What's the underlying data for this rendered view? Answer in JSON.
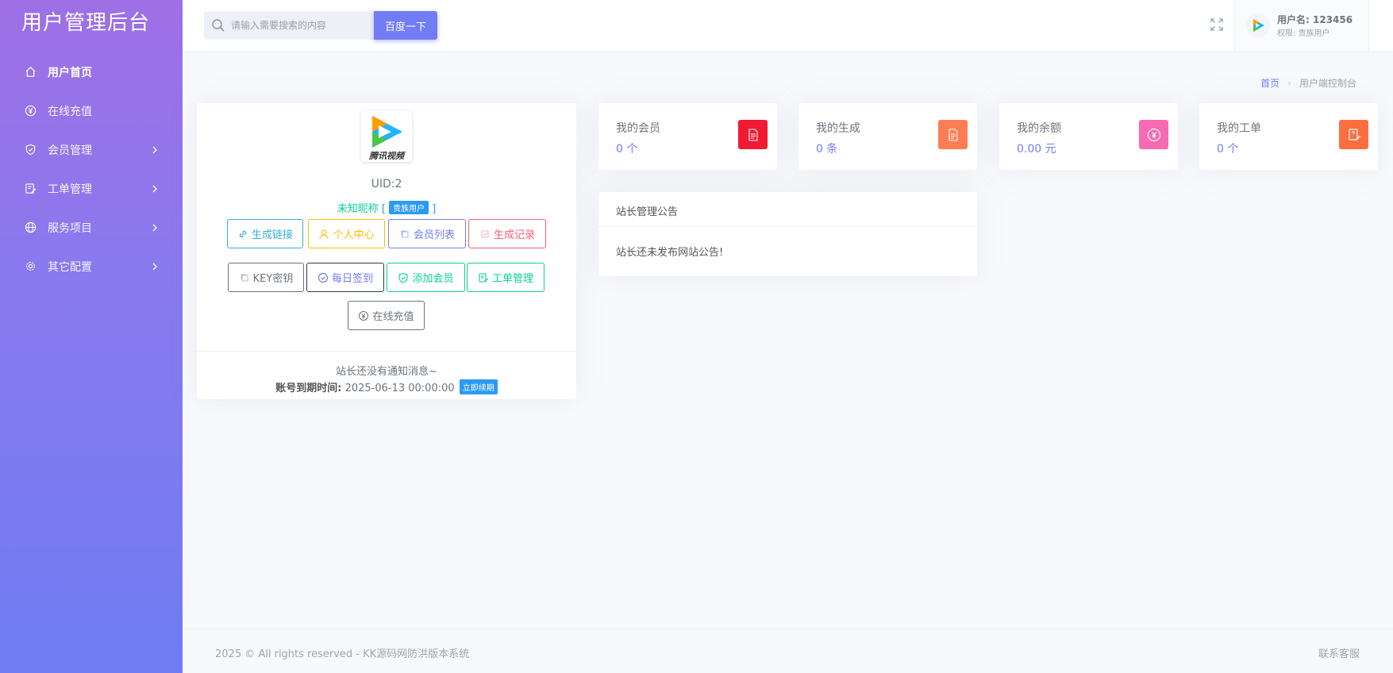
{
  "app": {
    "title": "用户管理后台"
  },
  "sidebar": {
    "items": [
      {
        "label": "用户首页",
        "icon": "home-icon",
        "active": true,
        "has_arrow": false
      },
      {
        "label": "在线充值",
        "icon": "yen-circle-icon",
        "active": false,
        "has_arrow": false
      },
      {
        "label": "会员管理",
        "icon": "shield-check-icon",
        "active": false,
        "has_arrow": true
      },
      {
        "label": "工单管理",
        "icon": "ticket-edit-icon",
        "active": false,
        "has_arrow": true
      },
      {
        "label": "服务项目",
        "icon": "globe-icon",
        "active": false,
        "has_arrow": true
      },
      {
        "label": "其它配置",
        "icon": "settings-gear-icon",
        "active": false,
        "has_arrow": true
      }
    ]
  },
  "search": {
    "placeholder": "请输入需要搜索的内容",
    "value": "",
    "button_label": "百度一下"
  },
  "user": {
    "name_label": "用户名: 123456",
    "role_label": "权限: 贵族用户"
  },
  "breadcrumb": {
    "home": "首页",
    "current": "用户端控制台"
  },
  "profile": {
    "logo_text": "腾讯视频",
    "uid": "UID:2",
    "nickname": "未知昵称",
    "bracket_open": "[",
    "bracket_close": "]",
    "role_badge": "贵族用户",
    "buttons": [
      {
        "label": "生成链接",
        "icon": "link-icon",
        "color": "#39afd1"
      },
      {
        "label": "个人中心",
        "icon": "user-icon",
        "color": "#ffbc00"
      },
      {
        "label": "会员列表",
        "icon": "copy-icon",
        "color": "#727cf5"
      },
      {
        "label": "生成记录",
        "icon": "chart-icon",
        "color": "#fa5c7c"
      },
      {
        "label": "KEY密钥",
        "icon": "copy-icon",
        "color": "#6c757d"
      },
      {
        "label": "每日签到",
        "icon": "check-circle-icon",
        "color": "#313a46"
      },
      {
        "label": "添加会员",
        "icon": "shield-check-icon",
        "color": "#0acf97"
      },
      {
        "label": "工单管理",
        "icon": "ticket-edit-icon",
        "color": "#0acf97"
      },
      {
        "label": "在线充值",
        "icon": "yen-circle-icon",
        "color": "#6c757d"
      }
    ],
    "notice": "站长还没有通知消息~",
    "expire_label": "账号到期时间:",
    "expire_value": "2025-06-13 00:00:00",
    "renew_label": "立即续期"
  },
  "stats": [
    {
      "title": "我的会员",
      "value": "0 个",
      "icon": "document-icon",
      "color": "#f01a33"
    },
    {
      "title": "我的生成",
      "value": "0 条",
      "icon": "document-icon",
      "color": "#fd7e54"
    },
    {
      "title": "我的余额",
      "value": "0.00 元",
      "icon": "yen-circle-icon",
      "color": "#f86ab1"
    },
    {
      "title": "我的工单",
      "value": "0 个",
      "icon": "ticket-edit-icon",
      "color": "#fd6e3e"
    }
  ],
  "announcement": {
    "title": "站长管理公告",
    "body": "站长还未发布网站公告!"
  },
  "footer": {
    "copyright": "2025 © All rights reserved - KK源码网防洪版本系统",
    "support": "联系客服"
  }
}
